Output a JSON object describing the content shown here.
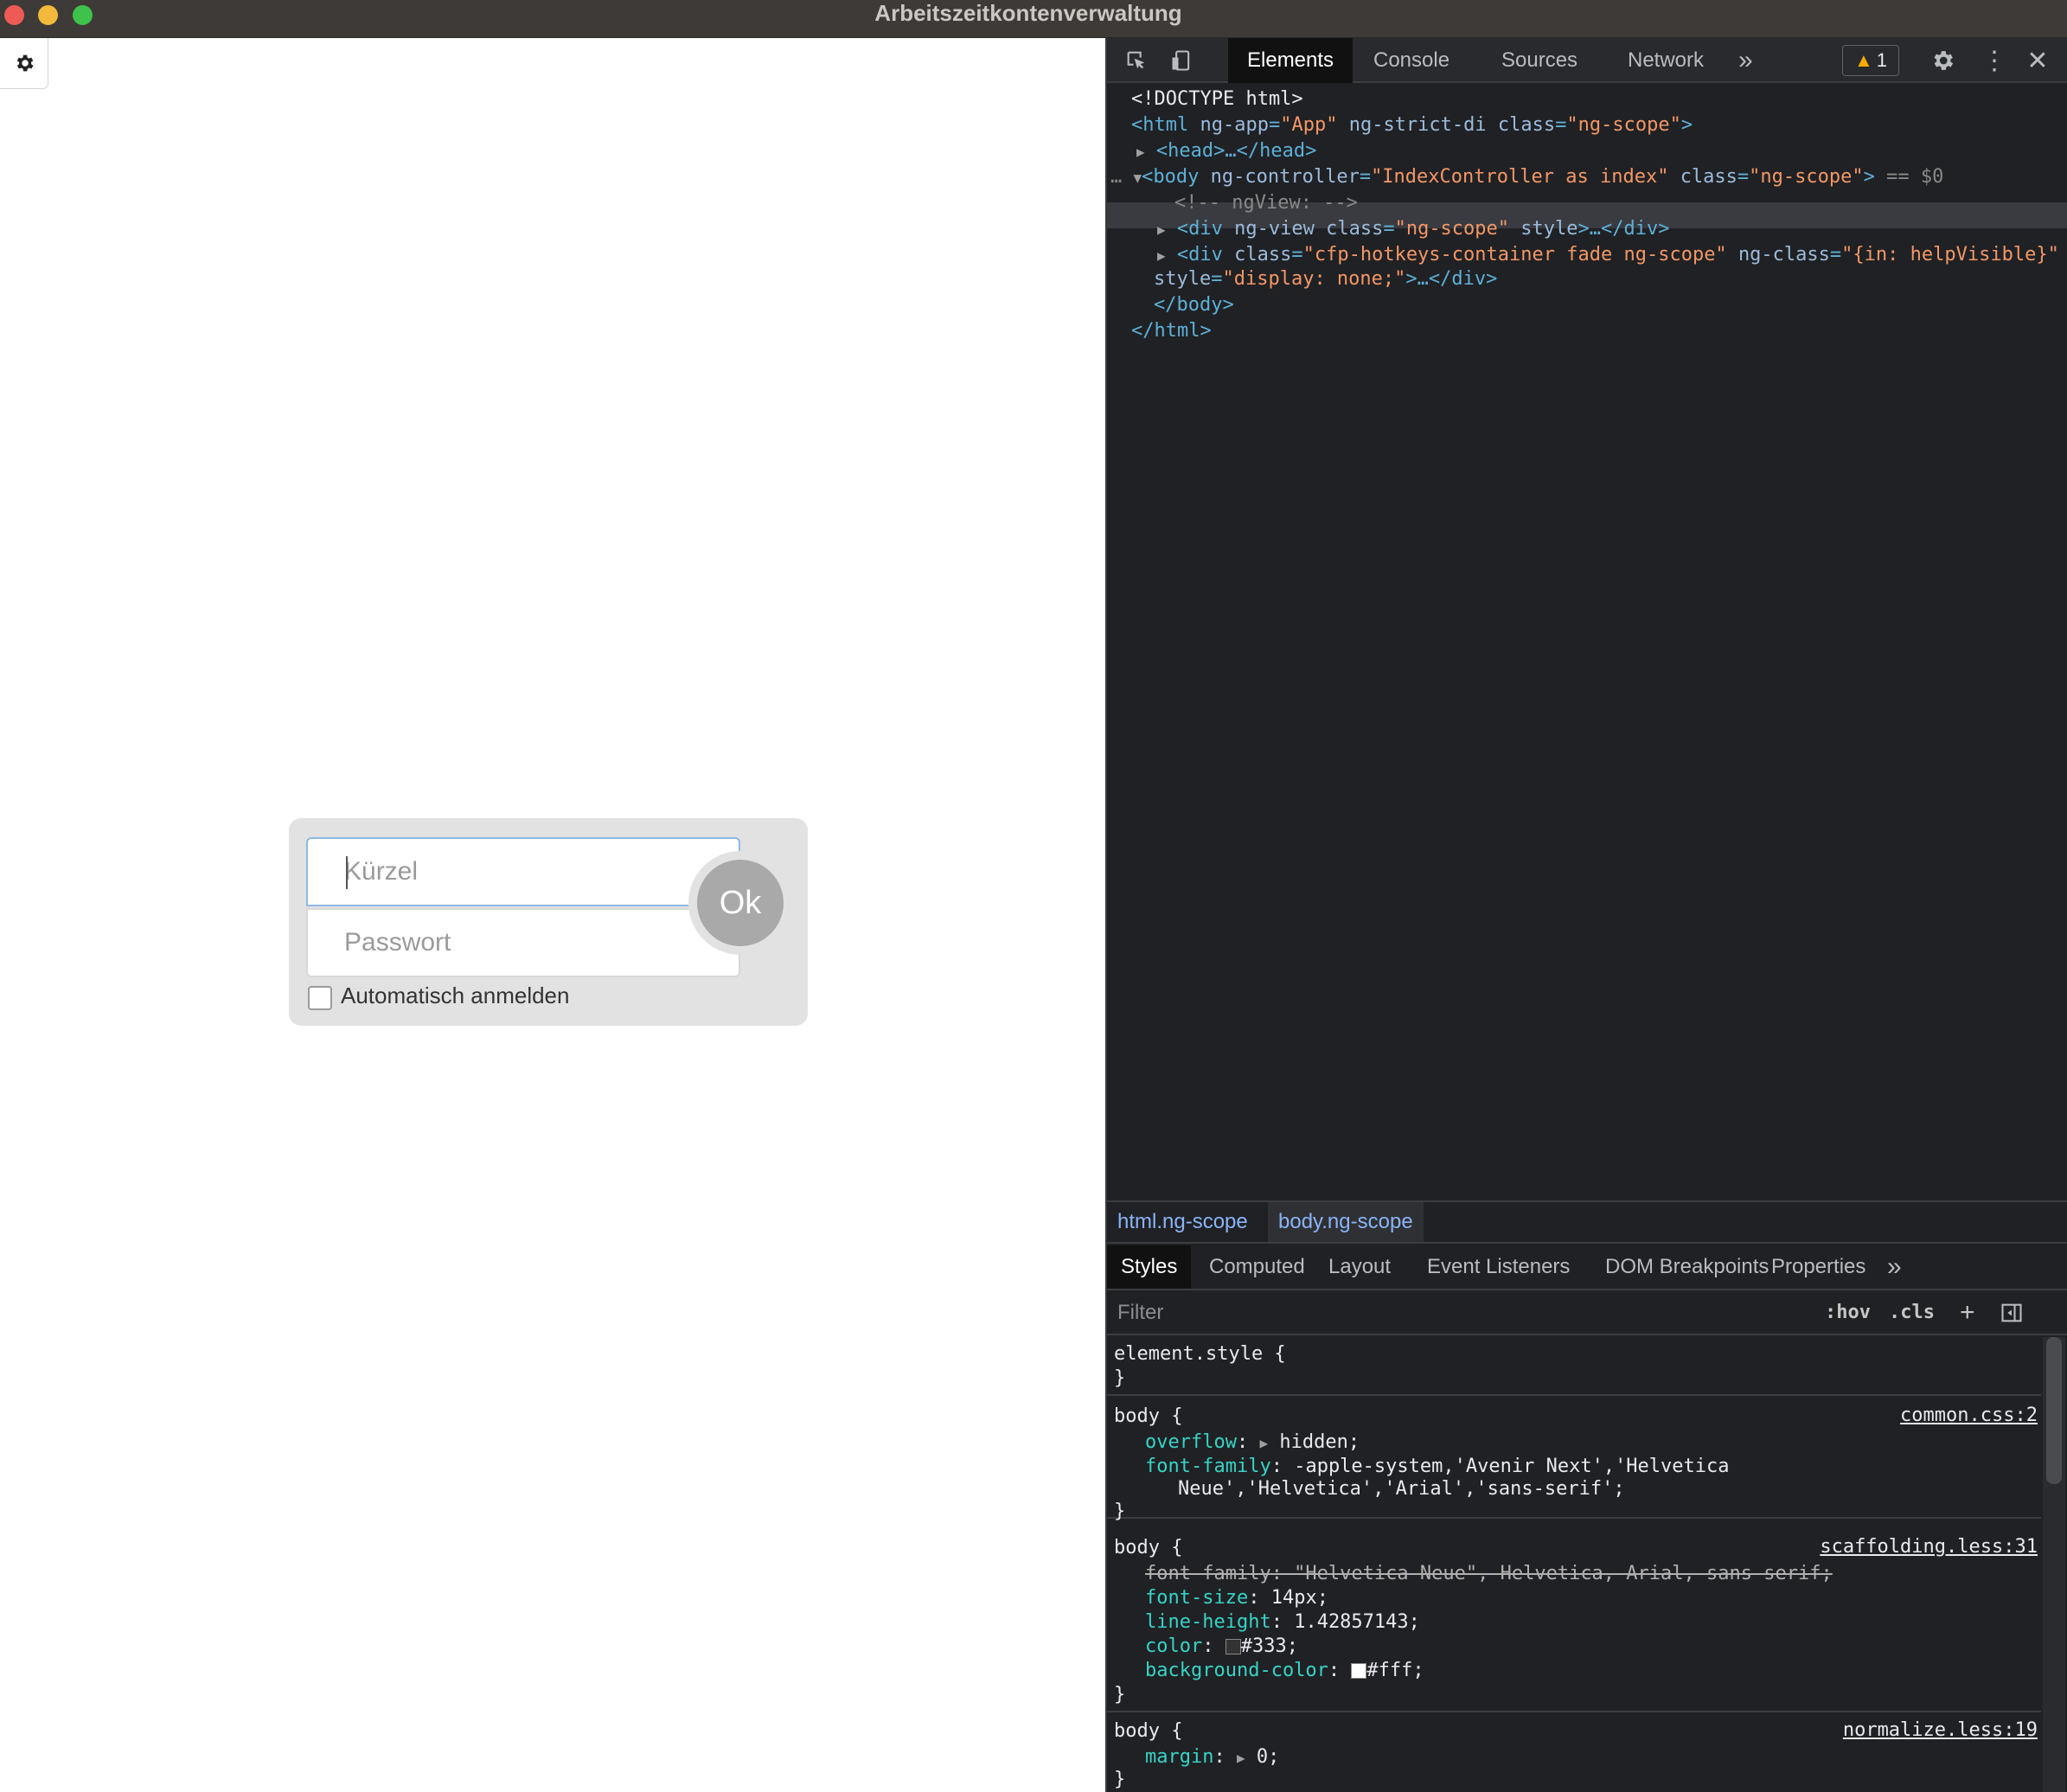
{
  "window": {
    "title": "Arbeitszeitkontenverwaltung"
  },
  "app": {
    "settings_icon": "gear-icon",
    "login": {
      "kuerzel_placeholder": "Kürzel",
      "passwort_placeholder": "Passwort",
      "ok_label": "Ok",
      "auto_login_label": "Automatisch anmelden",
      "auto_login_checked": false
    }
  },
  "devtools": {
    "tabs": [
      "Elements",
      "Console",
      "Sources",
      "Network"
    ],
    "more_tabs": "»",
    "warning_count": "1",
    "dom": {
      "doctype": "<!DOCTYPE html>",
      "html_open_tag": "<html",
      "html_attr1": "ng-app",
      "html_val1": "\"App\"",
      "html_attr2": "ng-strict-di",
      "html_attr3": "class",
      "html_val3": "\"ng-scope\"",
      "head": "<head>…</head>",
      "body_tag": "<body",
      "body_attr1": "ng-controller",
      "body_val1": "\"IndexController as index\"",
      "body_attr2": "class",
      "body_val2": "\"ng-scope\"",
      "body_selected_marker": "== $0",
      "comment": "<!-- ngView: -->",
      "div1_tag": "<div",
      "div1_attr1": "ng-view",
      "div1_attr2": "class",
      "div1_val2": "\"ng-scope\"",
      "div1_attr3": "style",
      "div1_rest": ">…</div>",
      "div2_tag": "<div",
      "div2_attr1": "class",
      "div2_val1": "\"cfp-hotkeys-container fade ng-scope\"",
      "div2_attr2": "ng-class",
      "div2_val2": "\"{in: helpVisible}\"",
      "div2_attr3": "style",
      "div2_val3": "\"display: none;\"",
      "div2_rest": ">…</div>",
      "body_close": "</body>",
      "html_close": "</html>"
    },
    "breadcrumbs": [
      "html.ng-scope",
      "body.ng-scope"
    ],
    "styles_tabs": [
      "Styles",
      "Computed",
      "Layout",
      "Event Listeners",
      "DOM Breakpoints",
      "Properties"
    ],
    "filter_placeholder": "Filter",
    "filter_buttons": [
      ":hov",
      ".cls",
      "+"
    ],
    "rules": {
      "element_style": "element.style {",
      "close": "}",
      "r1_selector": "body {",
      "r1_source": "common.css:2",
      "r1_p1": "overflow",
      "r1_v1": "hidden;",
      "r1_p2": "font-family",
      "r1_v2a": "-apple-system,'Avenir Next','Helvetica",
      "r1_v2b": "Neue','Helvetica','Arial','sans-serif';",
      "r2_selector": "body {",
      "r2_source": "scaffolding.less:31",
      "r2_strike": "font-family: \"Helvetica Neue\", Helvetica, Arial, sans-serif;",
      "r2_p1": "font-size",
      "r2_v1": "14px;",
      "r2_p2": "line-height",
      "r2_v2": "1.42857143;",
      "r2_p3": "color",
      "r2_v3": "#333;",
      "r2_p4": "background-color",
      "r2_v4": "#fff;",
      "r3_selector": "body {",
      "r3_source": "normalize.less:19",
      "r3_p1": "margin",
      "r3_v1": "0;"
    },
    "colors": {
      "swatch_333": "#333333",
      "swatch_fff": "#ffffff"
    }
  }
}
